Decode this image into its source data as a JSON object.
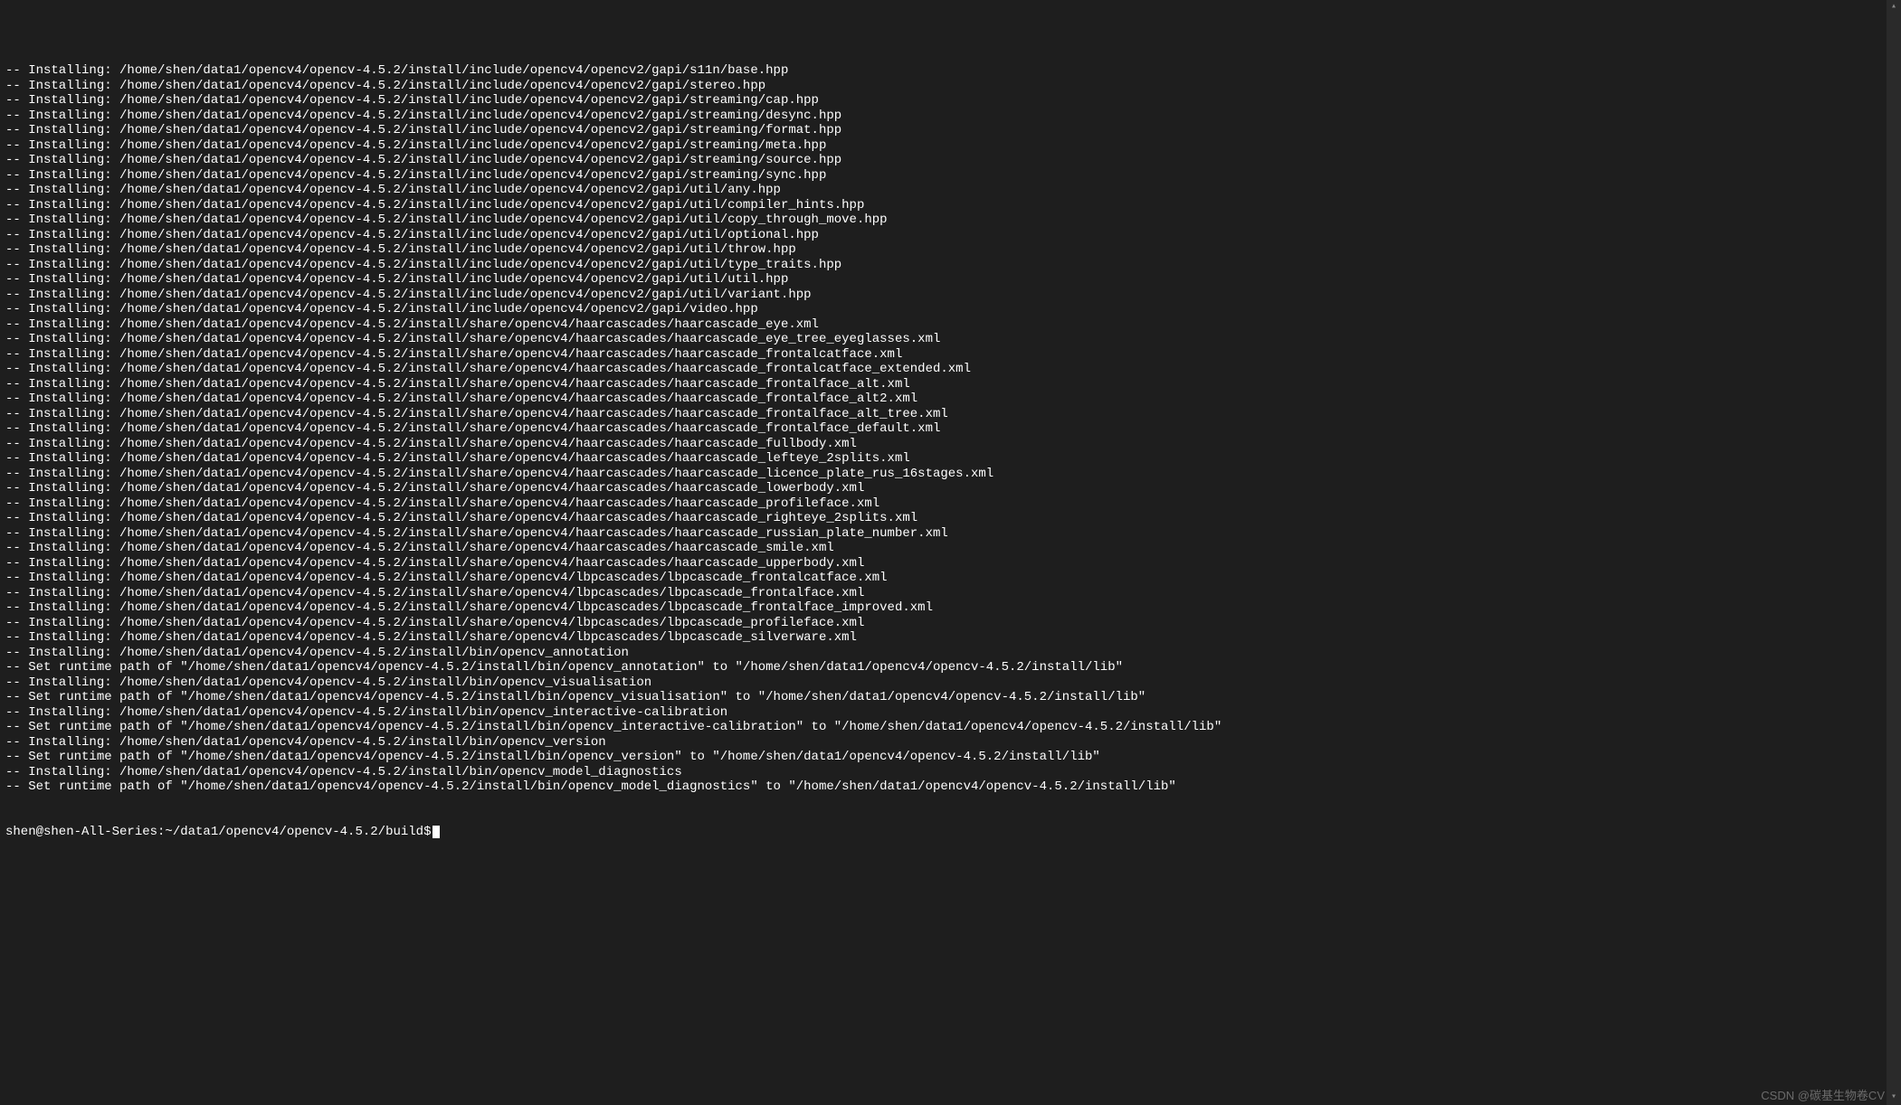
{
  "terminal": {
    "lines": [
      "-- Installing: /home/shen/data1/opencv4/opencv-4.5.2/install/include/opencv4/opencv2/gapi/s11n/base.hpp",
      "-- Installing: /home/shen/data1/opencv4/opencv-4.5.2/install/include/opencv4/opencv2/gapi/stereo.hpp",
      "-- Installing: /home/shen/data1/opencv4/opencv-4.5.2/install/include/opencv4/opencv2/gapi/streaming/cap.hpp",
      "-- Installing: /home/shen/data1/opencv4/opencv-4.5.2/install/include/opencv4/opencv2/gapi/streaming/desync.hpp",
      "-- Installing: /home/shen/data1/opencv4/opencv-4.5.2/install/include/opencv4/opencv2/gapi/streaming/format.hpp",
      "-- Installing: /home/shen/data1/opencv4/opencv-4.5.2/install/include/opencv4/opencv2/gapi/streaming/meta.hpp",
      "-- Installing: /home/shen/data1/opencv4/opencv-4.5.2/install/include/opencv4/opencv2/gapi/streaming/source.hpp",
      "-- Installing: /home/shen/data1/opencv4/opencv-4.5.2/install/include/opencv4/opencv2/gapi/streaming/sync.hpp",
      "-- Installing: /home/shen/data1/opencv4/opencv-4.5.2/install/include/opencv4/opencv2/gapi/util/any.hpp",
      "-- Installing: /home/shen/data1/opencv4/opencv-4.5.2/install/include/opencv4/opencv2/gapi/util/compiler_hints.hpp",
      "-- Installing: /home/shen/data1/opencv4/opencv-4.5.2/install/include/opencv4/opencv2/gapi/util/copy_through_move.hpp",
      "-- Installing: /home/shen/data1/opencv4/opencv-4.5.2/install/include/opencv4/opencv2/gapi/util/optional.hpp",
      "-- Installing: /home/shen/data1/opencv4/opencv-4.5.2/install/include/opencv4/opencv2/gapi/util/throw.hpp",
      "-- Installing: /home/shen/data1/opencv4/opencv-4.5.2/install/include/opencv4/opencv2/gapi/util/type_traits.hpp",
      "-- Installing: /home/shen/data1/opencv4/opencv-4.5.2/install/include/opencv4/opencv2/gapi/util/util.hpp",
      "-- Installing: /home/shen/data1/opencv4/opencv-4.5.2/install/include/opencv4/opencv2/gapi/util/variant.hpp",
      "-- Installing: /home/shen/data1/opencv4/opencv-4.5.2/install/include/opencv4/opencv2/gapi/video.hpp",
      "-- Installing: /home/shen/data1/opencv4/opencv-4.5.2/install/share/opencv4/haarcascades/haarcascade_eye.xml",
      "-- Installing: /home/shen/data1/opencv4/opencv-4.5.2/install/share/opencv4/haarcascades/haarcascade_eye_tree_eyeglasses.xml",
      "-- Installing: /home/shen/data1/opencv4/opencv-4.5.2/install/share/opencv4/haarcascades/haarcascade_frontalcatface.xml",
      "-- Installing: /home/shen/data1/opencv4/opencv-4.5.2/install/share/opencv4/haarcascades/haarcascade_frontalcatface_extended.xml",
      "-- Installing: /home/shen/data1/opencv4/opencv-4.5.2/install/share/opencv4/haarcascades/haarcascade_frontalface_alt.xml",
      "-- Installing: /home/shen/data1/opencv4/opencv-4.5.2/install/share/opencv4/haarcascades/haarcascade_frontalface_alt2.xml",
      "-- Installing: /home/shen/data1/opencv4/opencv-4.5.2/install/share/opencv4/haarcascades/haarcascade_frontalface_alt_tree.xml",
      "-- Installing: /home/shen/data1/opencv4/opencv-4.5.2/install/share/opencv4/haarcascades/haarcascade_frontalface_default.xml",
      "-- Installing: /home/shen/data1/opencv4/opencv-4.5.2/install/share/opencv4/haarcascades/haarcascade_fullbody.xml",
      "-- Installing: /home/shen/data1/opencv4/opencv-4.5.2/install/share/opencv4/haarcascades/haarcascade_lefteye_2splits.xml",
      "-- Installing: /home/shen/data1/opencv4/opencv-4.5.2/install/share/opencv4/haarcascades/haarcascade_licence_plate_rus_16stages.xml",
      "-- Installing: /home/shen/data1/opencv4/opencv-4.5.2/install/share/opencv4/haarcascades/haarcascade_lowerbody.xml",
      "-- Installing: /home/shen/data1/opencv4/opencv-4.5.2/install/share/opencv4/haarcascades/haarcascade_profileface.xml",
      "-- Installing: /home/shen/data1/opencv4/opencv-4.5.2/install/share/opencv4/haarcascades/haarcascade_righteye_2splits.xml",
      "-- Installing: /home/shen/data1/opencv4/opencv-4.5.2/install/share/opencv4/haarcascades/haarcascade_russian_plate_number.xml",
      "-- Installing: /home/shen/data1/opencv4/opencv-4.5.2/install/share/opencv4/haarcascades/haarcascade_smile.xml",
      "-- Installing: /home/shen/data1/opencv4/opencv-4.5.2/install/share/opencv4/haarcascades/haarcascade_upperbody.xml",
      "-- Installing: /home/shen/data1/opencv4/opencv-4.5.2/install/share/opencv4/lbpcascades/lbpcascade_frontalcatface.xml",
      "-- Installing: /home/shen/data1/opencv4/opencv-4.5.2/install/share/opencv4/lbpcascades/lbpcascade_frontalface.xml",
      "-- Installing: /home/shen/data1/opencv4/opencv-4.5.2/install/share/opencv4/lbpcascades/lbpcascade_frontalface_improved.xml",
      "-- Installing: /home/shen/data1/opencv4/opencv-4.5.2/install/share/opencv4/lbpcascades/lbpcascade_profileface.xml",
      "-- Installing: /home/shen/data1/opencv4/opencv-4.5.2/install/share/opencv4/lbpcascades/lbpcascade_silverware.xml",
      "-- Installing: /home/shen/data1/opencv4/opencv-4.5.2/install/bin/opencv_annotation",
      "-- Set runtime path of \"/home/shen/data1/opencv4/opencv-4.5.2/install/bin/opencv_annotation\" to \"/home/shen/data1/opencv4/opencv-4.5.2/install/lib\"",
      "-- Installing: /home/shen/data1/opencv4/opencv-4.5.2/install/bin/opencv_visualisation",
      "-- Set runtime path of \"/home/shen/data1/opencv4/opencv-4.5.2/install/bin/opencv_visualisation\" to \"/home/shen/data1/opencv4/opencv-4.5.2/install/lib\"",
      "-- Installing: /home/shen/data1/opencv4/opencv-4.5.2/install/bin/opencv_interactive-calibration",
      "-- Set runtime path of \"/home/shen/data1/opencv4/opencv-4.5.2/install/bin/opencv_interactive-calibration\" to \"/home/shen/data1/opencv4/opencv-4.5.2/install/lib\"",
      "-- Installing: /home/shen/data1/opencv4/opencv-4.5.2/install/bin/opencv_version",
      "-- Set runtime path of \"/home/shen/data1/opencv4/opencv-4.5.2/install/bin/opencv_version\" to \"/home/shen/data1/opencv4/opencv-4.5.2/install/lib\"",
      "-- Installing: /home/shen/data1/opencv4/opencv-4.5.2/install/bin/opencv_model_diagnostics",
      "-- Set runtime path of \"/home/shen/data1/opencv4/opencv-4.5.2/install/bin/opencv_model_diagnostics\" to \"/home/shen/data1/opencv4/opencv-4.5.2/install/lib\""
    ],
    "prompt": "shen@shen-All-Series:~/data1/opencv4/opencv-4.5.2/build$"
  },
  "watermark": "CSDN @碳基生物卷CV",
  "scrollbar": {
    "up_arrow": "▴",
    "down_arrow": "▾"
  }
}
